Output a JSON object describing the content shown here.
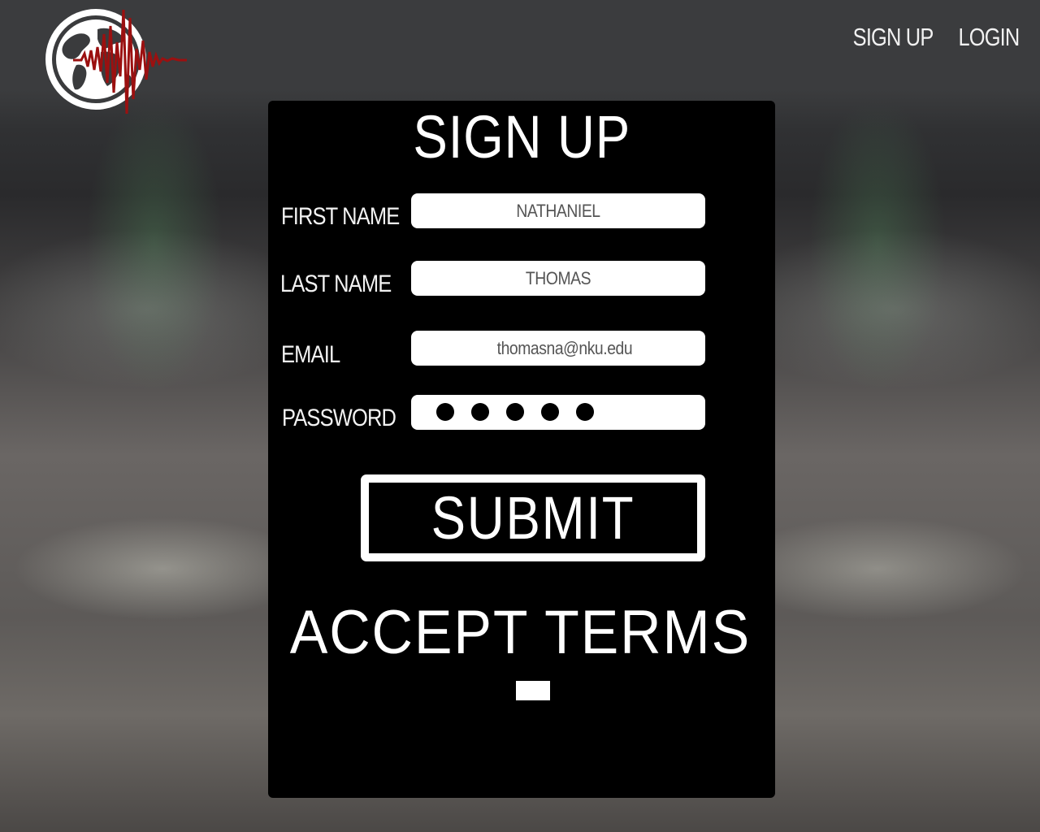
{
  "nav": {
    "signup_label": "SIGN UP",
    "login_label": "LOGIN"
  },
  "form": {
    "title": "SIGN UP",
    "first_name": {
      "label": "FIRST NAME",
      "value": "NATHANIEL"
    },
    "last_name": {
      "label": "LAST NAME",
      "value": "THOMAS"
    },
    "email": {
      "label": "EMAIL",
      "value": "thomasna@nku.edu"
    },
    "password": {
      "label": "PASSWORD",
      "masked_length": 5
    },
    "submit_label": "SUBMIT",
    "terms_label": "ACCEPT TERMS"
  },
  "icons": {
    "logo": "globe-seismograph-logo"
  },
  "colors": {
    "panel": "#000000",
    "logo_wave": "#9b1010",
    "text": "#ffffff"
  }
}
